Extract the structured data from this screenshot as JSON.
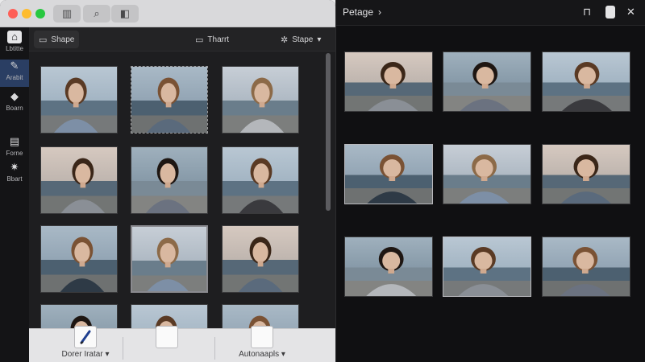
{
  "titlebar": {
    "buttons": [
      {
        "name": "library-icon",
        "glyph": "▥"
      },
      {
        "name": "search-icon",
        "glyph": "⌕"
      },
      {
        "name": "share-icon",
        "glyph": "◧"
      }
    ]
  },
  "sidebar": {
    "items": [
      {
        "label": "Lbtitte",
        "icon": "home-icon",
        "glyph": "⌂"
      },
      {
        "label": "Arabit",
        "icon": "edit-icon",
        "glyph": "✎"
      },
      {
        "label": "Boarn",
        "icon": "brush-icon",
        "glyph": "◆"
      },
      {
        "label": "Forne",
        "icon": "layers-icon",
        "glyph": "▤"
      },
      {
        "label": "Bbart",
        "icon": "gear-icon",
        "glyph": "✷"
      }
    ]
  },
  "toolbar": {
    "shape_label": "Shape",
    "trait_label": "Tharrt",
    "stape_label": "Stape",
    "chevron": "▾"
  },
  "dock": {
    "item1_label": "Dorer Iratar",
    "item3_label": "Autonaapls",
    "chevron": "▾"
  },
  "right": {
    "title": "Petage",
    "chevron": "›",
    "bookmark_glyph": "⊓",
    "close_glyph": "✕"
  },
  "colors": {
    "accent": "#2a3e63",
    "window_bg": "#1e1e20",
    "titlebar": "#d9d9db"
  }
}
